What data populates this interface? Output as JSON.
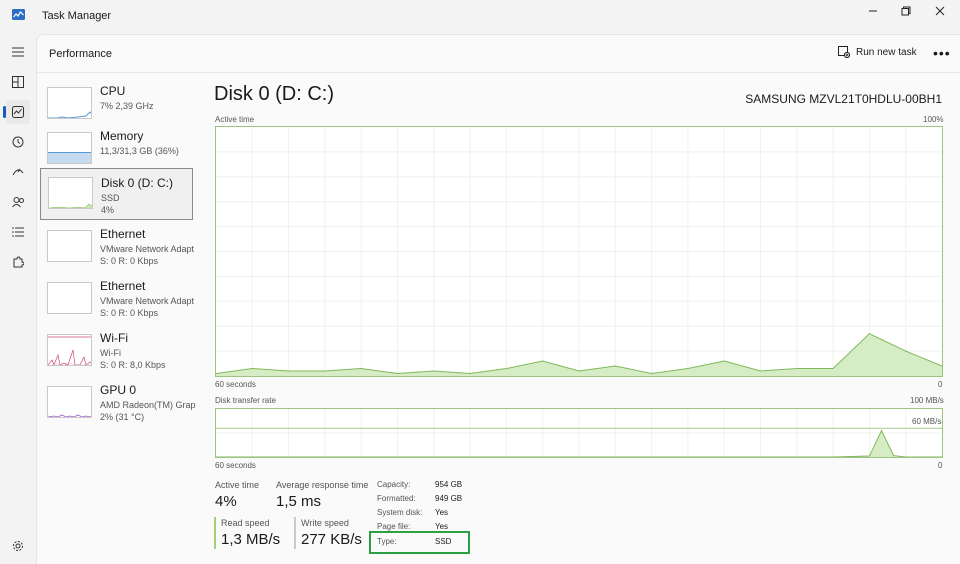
{
  "window": {
    "title": "Task Manager"
  },
  "header": {
    "page_title": "Performance",
    "run_task_label": "Run new task",
    "more_label": "•••"
  },
  "devices": [
    {
      "name": "CPU",
      "line1": "7% 2,39 GHz",
      "line2": ""
    },
    {
      "name": "Memory",
      "line1": "11,3/31,3 GB (36%)",
      "line2": ""
    },
    {
      "name": "Disk 0 (D: C:)",
      "line1": "SSD",
      "line2": "4%"
    },
    {
      "name": "Ethernet",
      "line1": "VMware Network Adapt",
      "line2": "S: 0 R: 0 Kbps"
    },
    {
      "name": "Ethernet",
      "line1": "VMware Network Adapt",
      "line2": "S: 0 R: 0 Kbps"
    },
    {
      "name": "Wi-Fi",
      "line1": "Wi-Fi",
      "line2": "S: 0 R: 8,0 Kbps"
    },
    {
      "name": "GPU 0",
      "line1": "AMD Radeon(TM) Grap.",
      "line2": "2% (31 °C)"
    }
  ],
  "detail": {
    "title": "Disk 0 (D: C:)",
    "model": "SAMSUNG MZVL21T0HDLU-00BH1",
    "active_time_label": "Active time",
    "active_time_max": "100%",
    "seconds_label": "60 seconds",
    "zero_label": "0",
    "transfer_label": "Disk transfer rate",
    "transfer_max": "100 MB/s",
    "transfer_mid": "60 MB/s",
    "stats": {
      "active_time_label": "Active time",
      "active_time_value": "4%",
      "avg_response_label": "Average response time",
      "avg_response_value": "1,5 ms",
      "read_label": "Read speed",
      "read_value": "1,3 MB/s",
      "write_label": "Write speed",
      "write_value": "277 KB/s"
    },
    "properties": [
      {
        "key": "Capacity:",
        "value": "954 GB"
      },
      {
        "key": "Formatted:",
        "value": "949 GB"
      },
      {
        "key": "System disk:",
        "value": "Yes"
      },
      {
        "key": "Page file:",
        "value": "Yes"
      },
      {
        "key": "Type:",
        "value": "SSD"
      }
    ]
  },
  "chart_data": [
    {
      "type": "area",
      "title": "Active time",
      "x": [
        60,
        57,
        54,
        51,
        48,
        45,
        42,
        39,
        36,
        33,
        30,
        27,
        24,
        21,
        18,
        15,
        12,
        9,
        6,
        3,
        0
      ],
      "values": [
        1,
        3,
        2,
        2,
        3,
        1,
        2,
        1,
        3,
        6,
        2,
        4,
        1,
        3,
        6,
        2,
        3,
        3,
        17,
        10,
        4
      ],
      "ylim": [
        0,
        100
      ],
      "color": "#9fd27a"
    },
    {
      "type": "area",
      "title": "Disk transfer rate",
      "x": [
        60,
        9,
        6,
        5,
        4,
        3,
        0
      ],
      "values": [
        0,
        0,
        2,
        55,
        3,
        0,
        0
      ],
      "ylim": [
        0,
        100
      ],
      "color": "#9fd27a"
    }
  ],
  "colors": {
    "accent": "#1a5fb4",
    "disk_green": "#9fd27a",
    "highlight_border": "#2da043"
  }
}
